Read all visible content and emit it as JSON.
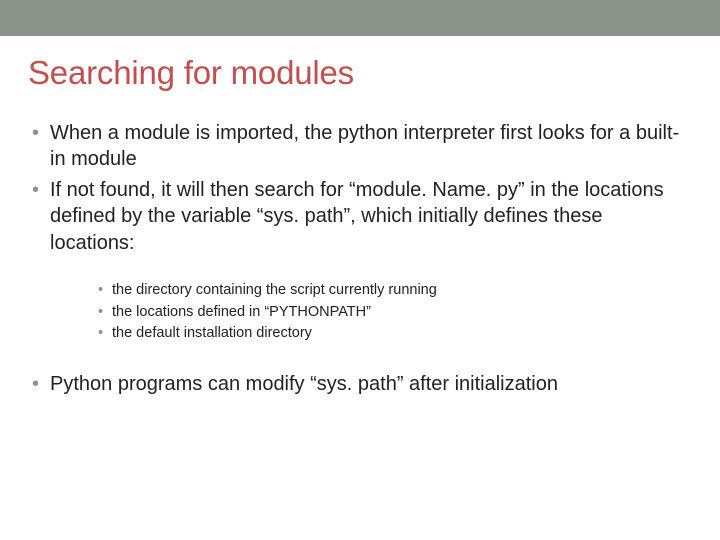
{
  "title": "Searching for modules",
  "bullets": {
    "b1": "When a module is imported, the python interpreter first looks for a built-in module",
    "b2": "If not found, it will then search for “module. Name. py” in the locations defined by the variable “sys. path”, which initially defines these locations:",
    "b3": "Python programs can modify “sys. path” after initialization"
  },
  "sub": {
    "s1": "the directory containing the script currently running",
    "s2": "the locations defined in “PYTHONPATH”",
    "s3": "the default installation directory"
  }
}
